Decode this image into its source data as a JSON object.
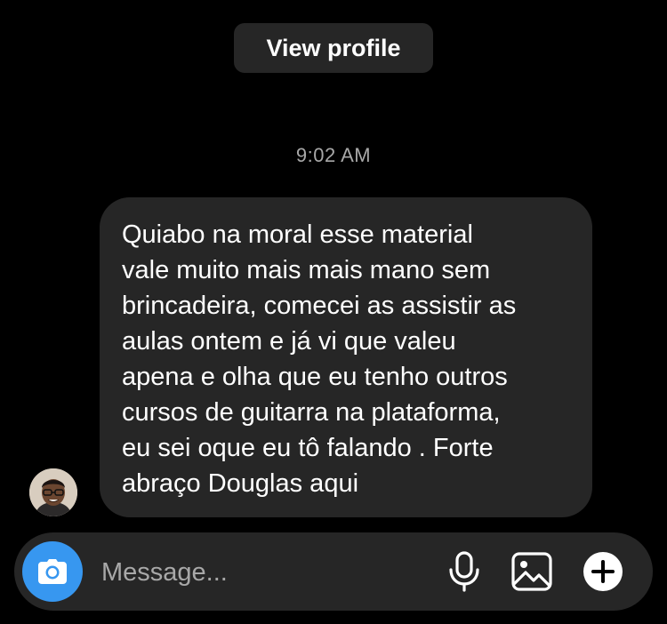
{
  "header": {
    "view_profile_label": "View profile"
  },
  "thread": {
    "timestamp": "9:02 AM",
    "message": "Quiabo na moral esse material\nvale muito mais mais mano sem\nbrincadeira, comecei as assistir as\naulas ontem e já vi que valeu\napena e olha que eu tenho outros\ncursos de guitarra na plataforma,\neu sei oque eu tô falando  . Forte\nabraço Douglas aqui"
  },
  "composer": {
    "placeholder": "Message...",
    "value": "",
    "icons": [
      "camera-icon",
      "microphone-icon",
      "gallery-icon",
      "plus-icon"
    ]
  },
  "colors": {
    "background": "#000000",
    "bubble": "#262626",
    "accent": "#3797f0",
    "muted_text": "#a8a8a8"
  }
}
